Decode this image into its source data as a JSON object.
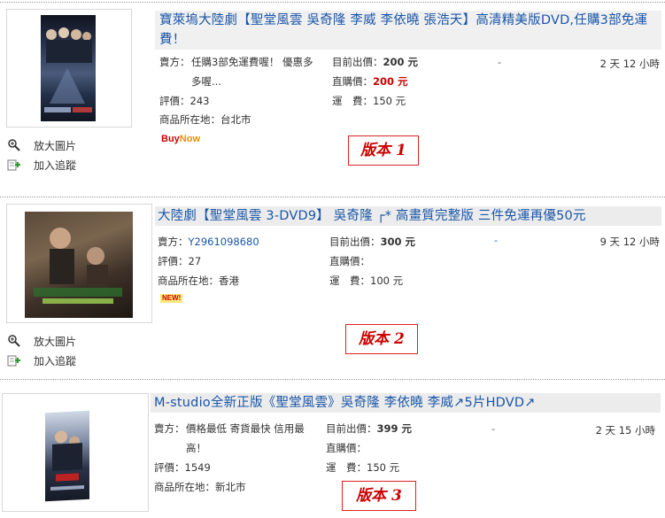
{
  "listings": [
    {
      "title": "寶萊塢大陸劇【聖堂風雲 吳奇隆 李威 李依曉 張浩天】高清精美版DVD,任購3部免運費！",
      "seller_label": "賣方：",
      "seller_value": "任購3部免運費喔！ 優惠多多喔...",
      "rating_label": "評價：",
      "rating_value": "243",
      "location_label": "商品所在地：",
      "location_value": "台北市",
      "current_bid_label": "目前出價：",
      "current_bid_value": "200 元",
      "buy_now_price_label": "直購價：",
      "buy_now_price_value": "200 元",
      "shipping_label": "運　費：",
      "shipping_value": "150 元",
      "bids": "-",
      "time_left": "2 天 12 小時",
      "badge_buy": "Buy",
      "badge_now": "Now",
      "enlarge_label": "放大圖片",
      "track_label": "加入追蹤",
      "version_label": "版本 1"
    },
    {
      "title": "大陸劇【聖堂風雲 3-DVD9】 吳奇隆 ┌* 高畫質完整版 三件免運再優50元",
      "seller_label": "賣方：",
      "seller_value": "Y2961098680",
      "rating_label": "評價：",
      "rating_value": "27",
      "location_label": "商品所在地：",
      "location_value": "香港",
      "current_bid_label": "目前出價：",
      "current_bid_value": "300 元",
      "buy_now_price_label": "直購價：",
      "buy_now_price_value": "",
      "shipping_label": "運　費：",
      "shipping_value": "100 元",
      "bids": "-",
      "time_left": "9 天 12 小時",
      "badge_new": "NEW!",
      "enlarge_label": "放大圖片",
      "track_label": "加入追蹤",
      "version_label": "版本 2"
    },
    {
      "title": "M-studio全新正版《聖堂風雲》吳奇隆 李依曉 李威↗5片HDVD↗",
      "seller_label": "賣方：",
      "seller_value": "價格最低 寄貨最快 信用最高！",
      "rating_label": "評價：",
      "rating_value": "1549",
      "location_label": "商品所在地：",
      "location_value": "新北市",
      "current_bid_label": "目前出價：",
      "current_bid_value": "399 元",
      "buy_now_price_label": "直購價：",
      "buy_now_price_value": "",
      "shipping_label": "運　費：",
      "shipping_value": "150 元",
      "bids": "-",
      "time_left": "2 天 15 小時",
      "version_label": "版本 3"
    }
  ],
  "colors": {
    "title_link": "#1a56a8",
    "price_red": "#cc0000",
    "version_border": "#dd2222",
    "title_bar_bg": "#ececec"
  }
}
